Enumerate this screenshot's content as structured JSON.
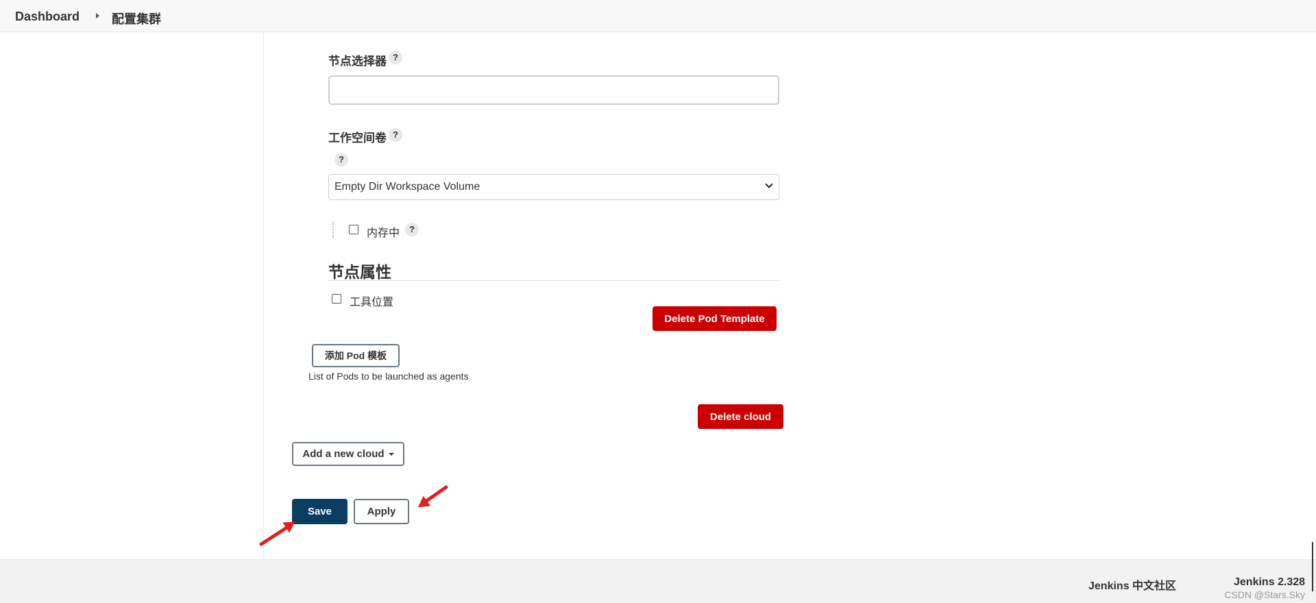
{
  "breadcrumb": {
    "items": [
      {
        "label": "Dashboard"
      },
      {
        "label": "配置集群"
      }
    ]
  },
  "form": {
    "node_selector": {
      "label": "节点选择器",
      "value": "",
      "help": "?"
    },
    "workspace_volume": {
      "label": "工作空间卷",
      "help": "?",
      "sub_help": "?",
      "selected": "Empty Dir Workspace Volume",
      "in_memory": {
        "label": "内存中",
        "checked": false,
        "help": "?"
      }
    },
    "node_properties": {
      "heading": "节点属性",
      "tool_location": {
        "label": "工具位置",
        "checked": false
      }
    },
    "delete_pod_template": "Delete Pod Template",
    "add_pod_template": "添加 Pod 模板",
    "pods_hint": "List of Pods to be launched as agents",
    "delete_cloud": "Delete cloud",
    "add_new_cloud": "Add a new cloud",
    "save": "Save",
    "apply": "Apply"
  },
  "footer": {
    "community": "Jenkins 中文社区",
    "version": "Jenkins 2.328",
    "watermark": "CSDN @Stars.Sky"
  },
  "colors": {
    "primary": "#0b3d62",
    "danger": "#cc0000",
    "annotation_arrow": "#e02020"
  }
}
